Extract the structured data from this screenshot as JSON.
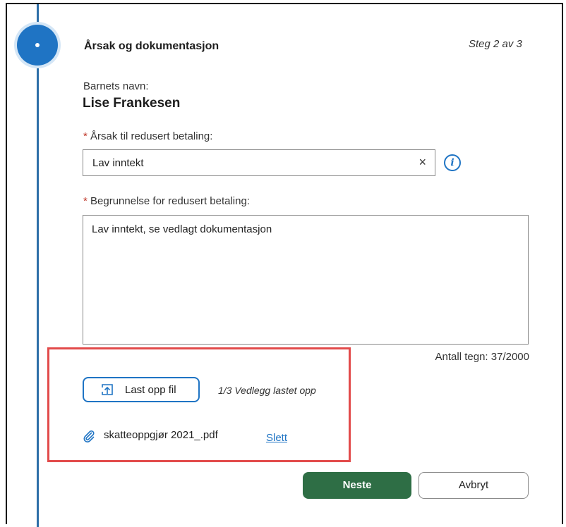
{
  "step": {
    "title": "Årsak og dokumentasjon",
    "counter": "Steg 2 av 3"
  },
  "child": {
    "label": "Barnets navn:",
    "name": "Lise Frankesen"
  },
  "reason": {
    "required_mark": "*",
    "label": "Årsak til redusert betaling:",
    "value": "Lav inntekt",
    "clear_icon": "×"
  },
  "justification": {
    "required_mark": "*",
    "label": "Begrunnelse for redusert betaling:",
    "value": "Lav inntekt, se vedlagt dokumentasjon",
    "char_count": "Antall tegn: 37/2000"
  },
  "upload": {
    "button_label": "Last opp fil",
    "status": "1/3 Vedlegg lastet opp",
    "files": [
      {
        "name": "skatteoppgjør 2021_.pdf",
        "delete_label": "Slett"
      }
    ]
  },
  "actions": {
    "next_label": "Neste",
    "cancel_label": "Avbryt"
  },
  "colors": {
    "accent": "#1f74c4",
    "primary_button": "#2e6e45",
    "highlight": "#e24b4b"
  }
}
